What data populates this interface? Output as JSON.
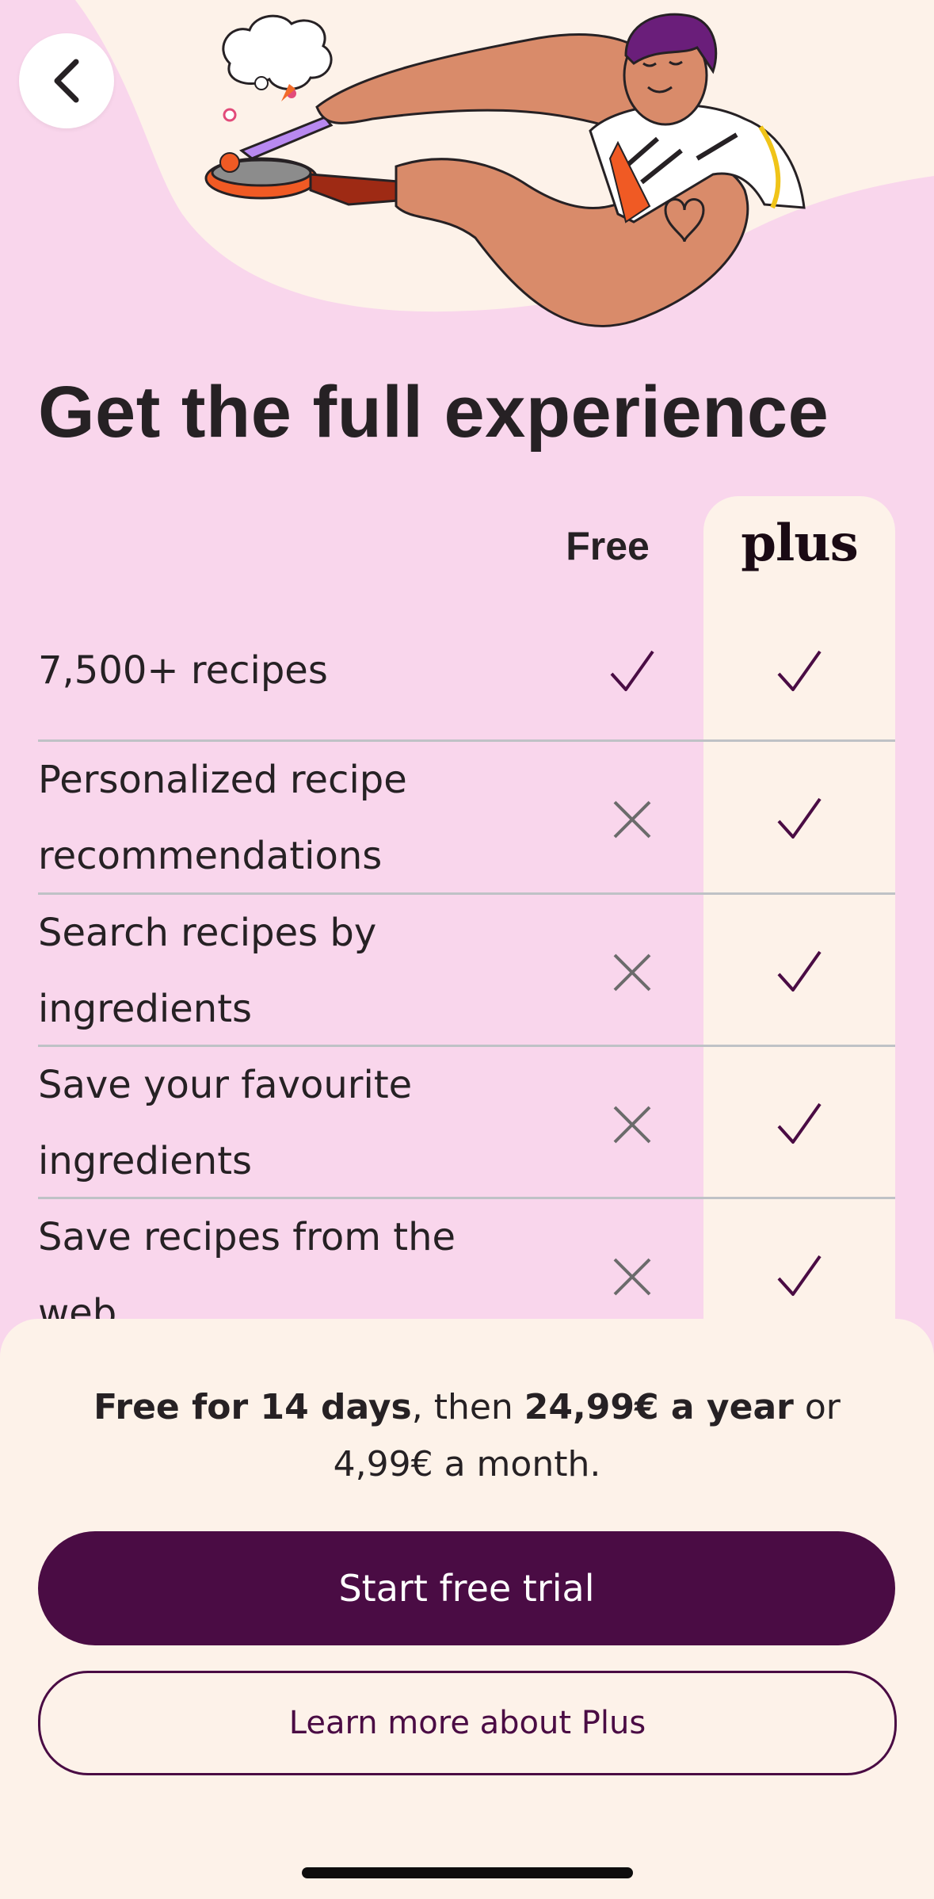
{
  "header": {
    "back_icon": "chevron-left-icon",
    "illustration": "chef-cooking-illustration"
  },
  "title": "Get the full experience",
  "columns": {
    "free": "Free",
    "plus": "plus"
  },
  "features": [
    {
      "label": "7,500+ recipes",
      "free": true,
      "plus": true
    },
    {
      "label": "Personalized recipe recommendations",
      "free": false,
      "plus": true
    },
    {
      "label": "Search recipes by ingredients",
      "free": false,
      "plus": true
    },
    {
      "label": "Save your favourite ingredients",
      "free": false,
      "plus": true
    },
    {
      "label": "Save recipes from the web",
      "free": false,
      "plus": true
    }
  ],
  "pricing": {
    "bold_1": "Free for 14 days",
    "text_1": ", then ",
    "bold_2": "24,99€ a year",
    "text_2": " or 4,99€ a month."
  },
  "buttons": {
    "primary": "Start free trial",
    "secondary": "Learn more about Plus"
  },
  "colors": {
    "background": "#f9d6ec",
    "sheet": "#fdf2e9",
    "accent": "#4a0c44"
  }
}
